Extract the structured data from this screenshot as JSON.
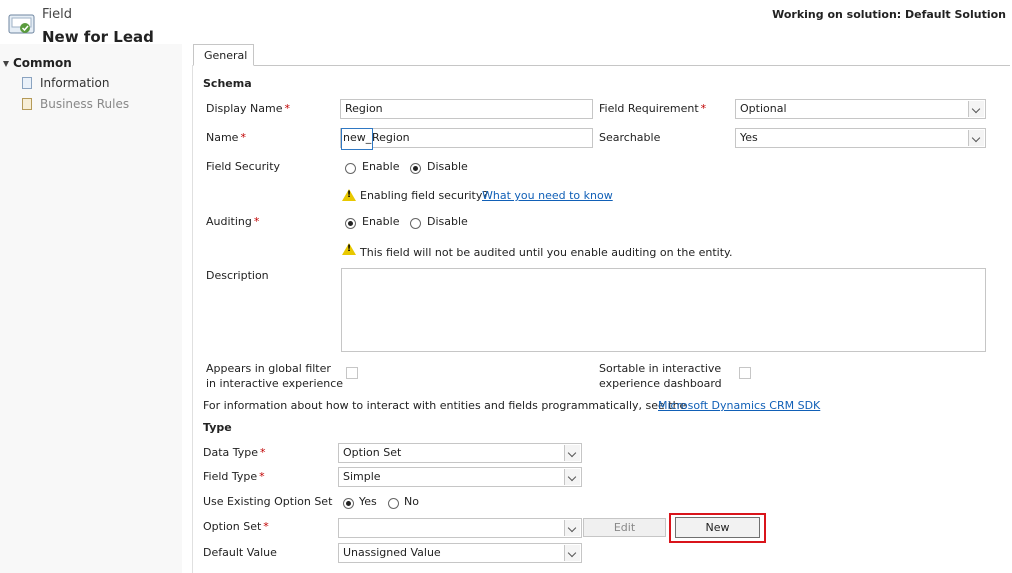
{
  "header": {
    "entity_type": "Field",
    "title": "New for Lead",
    "solution_text": "Working on solution: Default Solution"
  },
  "sidebar": {
    "group_label": "Common",
    "items": [
      {
        "label": "Information",
        "icon": "information-icon"
      },
      {
        "label": "Business Rules",
        "icon": "business-rules-icon"
      }
    ]
  },
  "tabs": [
    {
      "label": "General"
    }
  ],
  "schema": {
    "heading": "Schema",
    "display_name": {
      "label": "Display Name",
      "value": "Region"
    },
    "name": {
      "label": "Name",
      "prefix": "new_",
      "value": "Region"
    },
    "field_requirement": {
      "label": "Field Requirement",
      "value": "Optional"
    },
    "searchable": {
      "label": "Searchable",
      "value": "Yes"
    },
    "field_security": {
      "label": "Field Security",
      "options": [
        "Enable",
        "Disable"
      ],
      "selected": "Disable"
    },
    "field_security_warning": "Enabling field security?",
    "field_security_link": "What you need to know",
    "auditing": {
      "label": "Auditing",
      "options": [
        "Enable",
        "Disable"
      ],
      "selected": "Enable"
    },
    "auditing_warning": "This field will not be audited until you enable auditing on the entity.",
    "description": {
      "label": "Description",
      "value": ""
    },
    "global_filter_label_1": "Appears in global filter",
    "global_filter_label_2": "in interactive experience",
    "sortable_label_1": "Sortable in interactive",
    "sortable_label_2": "experience dashboard",
    "sdk_text": "For information about how to interact with entities and fields programmatically, see the",
    "sdk_link": "Microsoft Dynamics CRM SDK"
  },
  "type": {
    "heading": "Type",
    "data_type": {
      "label": "Data Type",
      "value": "Option Set"
    },
    "field_type": {
      "label": "Field Type",
      "value": "Simple"
    },
    "use_existing": {
      "label": "Use Existing Option Set",
      "options": [
        "Yes",
        "No"
      ],
      "selected": "Yes"
    },
    "option_set": {
      "label": "Option Set",
      "value": ""
    },
    "edit_label": "Edit",
    "new_label": "New",
    "default_value": {
      "label": "Default Value",
      "value": "Unassigned Value"
    }
  },
  "colors": {
    "highlight": "#d9141b",
    "link": "#1160b7",
    "required": "#c00000",
    "sidebar_bg": "#f8f8f8"
  }
}
